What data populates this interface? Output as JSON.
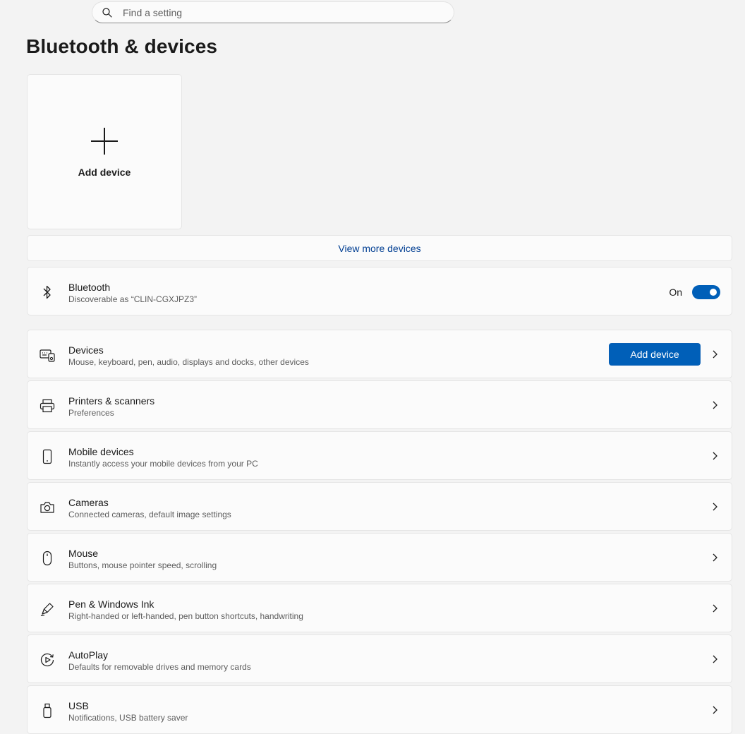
{
  "search": {
    "placeholder": "Find a setting",
    "icon": "search-icon"
  },
  "page": {
    "title": "Bluetooth & devices"
  },
  "add_device_card": {
    "label": "Add device",
    "icon": "plus-icon"
  },
  "view_more": {
    "label": "View more devices"
  },
  "bluetooth": {
    "title": "Bluetooth",
    "subtitle": "Discoverable as “CLIN-CGXJPZ3”",
    "toggle_label": "On",
    "toggle_on": true,
    "icon": "bluetooth-icon"
  },
  "rows": [
    {
      "id": "devices",
      "title": "Devices",
      "subtitle": "Mouse, keyboard, pen, audio, displays and docks, other devices",
      "button": "Add device",
      "icon": "devices-icon"
    },
    {
      "id": "printers",
      "title": "Printers & scanners",
      "subtitle": "Preferences",
      "icon": "printer-icon"
    },
    {
      "id": "mobile",
      "title": "Mobile devices",
      "subtitle": "Instantly access your mobile devices from your PC",
      "icon": "phone-icon"
    },
    {
      "id": "cameras",
      "title": "Cameras",
      "subtitle": "Connected cameras, default image settings",
      "icon": "camera-icon"
    },
    {
      "id": "mouse",
      "title": "Mouse",
      "subtitle": "Buttons, mouse pointer speed, scrolling",
      "icon": "mouse-icon"
    },
    {
      "id": "pen",
      "title": "Pen & Windows Ink",
      "subtitle": "Right-handed or left-handed, pen button shortcuts, handwriting",
      "icon": "pen-icon"
    },
    {
      "id": "autoplay",
      "title": "AutoPlay",
      "subtitle": "Defaults for removable drives and memory cards",
      "icon": "autoplay-icon"
    },
    {
      "id": "usb",
      "title": "USB",
      "subtitle": "Notifications, USB battery saver",
      "icon": "usb-icon"
    }
  ],
  "colors": {
    "accent": "#005fb8",
    "link": "#003e92",
    "background": "#f3f3f3",
    "card": "#fbfbfb"
  }
}
